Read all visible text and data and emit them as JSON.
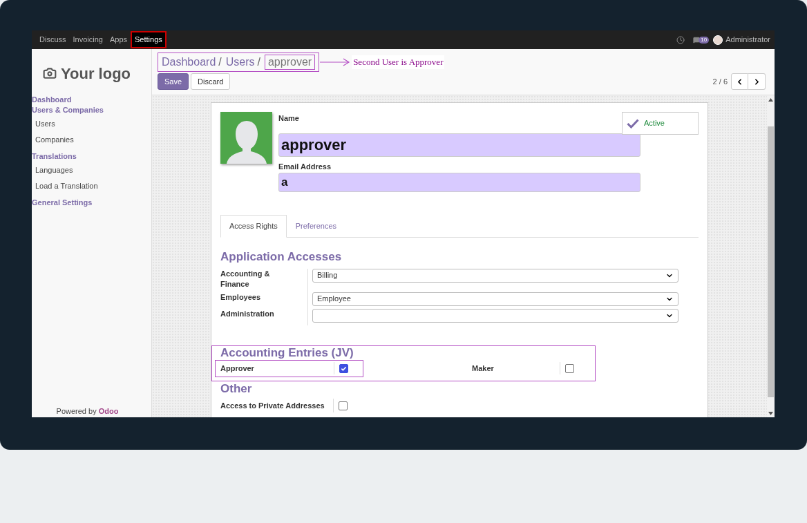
{
  "navbar": {
    "menu": [
      {
        "label": "Discuss",
        "selected": false
      },
      {
        "label": "Invoicing",
        "selected": false
      },
      {
        "label": "Apps",
        "selected": false
      },
      {
        "label": "Settings",
        "selected": true
      }
    ],
    "message_count": "10",
    "user": "Administrator"
  },
  "sidebar": {
    "logo": "Your logo",
    "sections": [
      {
        "label": "Dashboard"
      },
      {
        "label": "Users & Companies",
        "children": [
          {
            "label": "Users"
          },
          {
            "label": "Companies"
          }
        ]
      },
      {
        "label": "Translations",
        "children": [
          {
            "label": "Languages"
          },
          {
            "label": "Load a Translation"
          }
        ]
      },
      {
        "label": "General Settings"
      }
    ],
    "footer": "Powered by",
    "footer_brand": "Odoo"
  },
  "breadcrumb": [
    {
      "label": "Dashboard",
      "separator": "/"
    },
    {
      "label": "Users",
      "separator": "/"
    },
    {
      "label": "approver"
    }
  ],
  "annotation": "Second User is Approver",
  "buttons": {
    "save": "Save",
    "discard": "Discard"
  },
  "pager": "2 / 6",
  "form": {
    "name_label": "Name",
    "name_value": "approver",
    "email_label": "Email Address",
    "email_value": "a",
    "active": {
      "label": "Active",
      "on": true
    },
    "tabs": [
      {
        "label": "Access Rights",
        "selected": true
      },
      {
        "label": "Preferences",
        "selected": false
      }
    ],
    "application_accesses": {
      "title": "Application Accesses",
      "rows": [
        {
          "label": "Accounting & Finance",
          "value": "Billing"
        },
        {
          "label": "Employees",
          "value": "Employee"
        },
        {
          "label": "Administration",
          "value": ""
        }
      ]
    },
    "accounting_entries": {
      "title": "Accounting Entries (JV)",
      "items": [
        {
          "label": "Approver",
          "checked": true
        },
        {
          "label": "Maker",
          "checked": false
        }
      ]
    },
    "other": {
      "title": "Other",
      "items": [
        {
          "label": "Access to Private Addresses",
          "checked": false
        }
      ]
    }
  }
}
